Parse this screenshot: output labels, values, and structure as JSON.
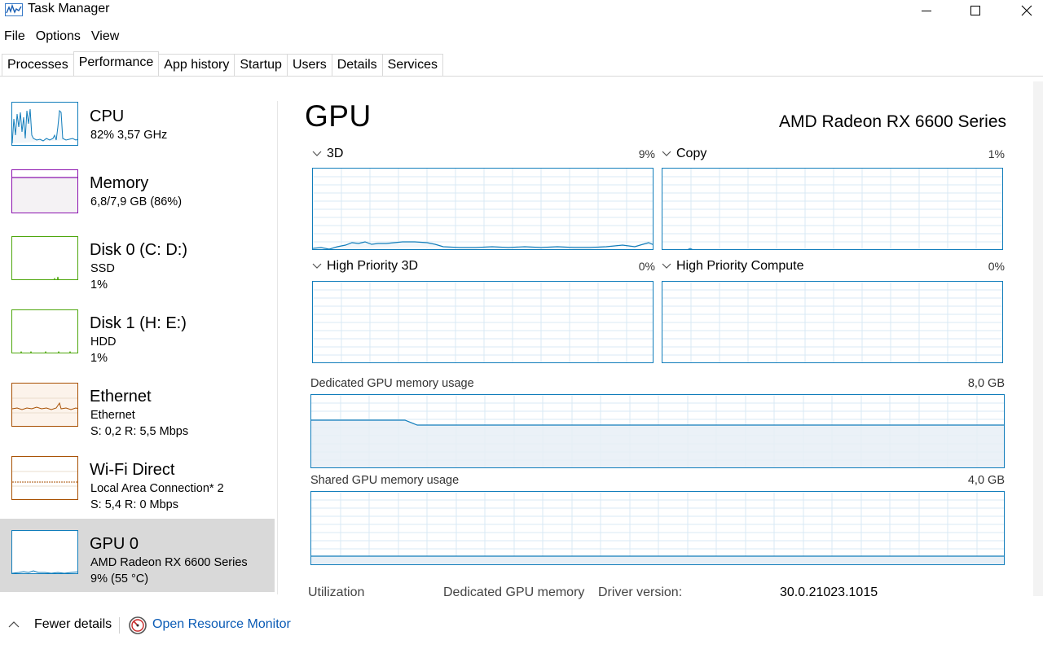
{
  "window": {
    "title": "Task Manager",
    "icons": {
      "app": "task-manager-icon",
      "minimize": "minimize-icon",
      "maximize": "maximize-icon",
      "close": "close-icon"
    }
  },
  "menu": [
    "File",
    "Options",
    "View"
  ],
  "tabs": [
    "Processes",
    "Performance",
    "App history",
    "Startup",
    "Users",
    "Details",
    "Services"
  ],
  "active_tab": "Performance",
  "sidebar": [
    {
      "title": "CPU",
      "line1": "82% 3,57 GHz",
      "line2": "",
      "color": "#117dbb",
      "selected": false
    },
    {
      "title": "Memory",
      "line1": "6,8/7,9 GB (86%)",
      "line2": "",
      "color": "#8b12ae",
      "selected": false
    },
    {
      "title": "Disk 0 (C: D:)",
      "line1": "SSD",
      "line2": "1%",
      "color": "#4da60c",
      "selected": false
    },
    {
      "title": "Disk 1 (H: E:)",
      "line1": "HDD",
      "line2": "1%",
      "color": "#4da60c",
      "selected": false
    },
    {
      "title": "Ethernet",
      "line1": "Ethernet",
      "line2": "S: 0,2  R: 5,5 Mbps",
      "color": "#a74f01",
      "selected": false
    },
    {
      "title": "Wi-Fi Direct",
      "line1": "Local Area Connection* 2",
      "line2": "S: 5,4  R: 0 Mbps",
      "color": "#a74f01",
      "selected": false
    },
    {
      "title": "GPU 0",
      "line1": "AMD Radeon RX 6600 Series",
      "line2": "9%  (55 °C)",
      "color": "#117dbb",
      "selected": true
    }
  ],
  "main": {
    "title": "GPU",
    "device_name": "AMD Radeon RX 6600 Series",
    "engines": [
      {
        "label": "3D",
        "percent": "9%"
      },
      {
        "label": "Copy",
        "percent": "1%"
      },
      {
        "label": "High Priority 3D",
        "percent": "0%"
      },
      {
        "label": "High Priority Compute",
        "percent": "0%"
      }
    ],
    "dedicated_memory": {
      "label": "Dedicated GPU memory usage",
      "max": "8,0 GB"
    },
    "shared_memory": {
      "label": "Shared GPU memory usage",
      "max": "4,0 GB"
    },
    "stats": {
      "utilization_label": "Utilization",
      "dedicated_label": "Dedicated GPU memory",
      "driver_label": "Driver version:",
      "driver_value": "30.0.21023.1015"
    }
  },
  "footer": {
    "fewer_details": "Fewer details",
    "open_resource_monitor": "Open Resource Monitor"
  },
  "colors": {
    "gpu_line": "#117dbb",
    "grid": "#d9eaf4",
    "memory_fill": "#f1f6fa",
    "selected_bg": "#d9d9d9",
    "link": "#0a5bb5"
  }
}
